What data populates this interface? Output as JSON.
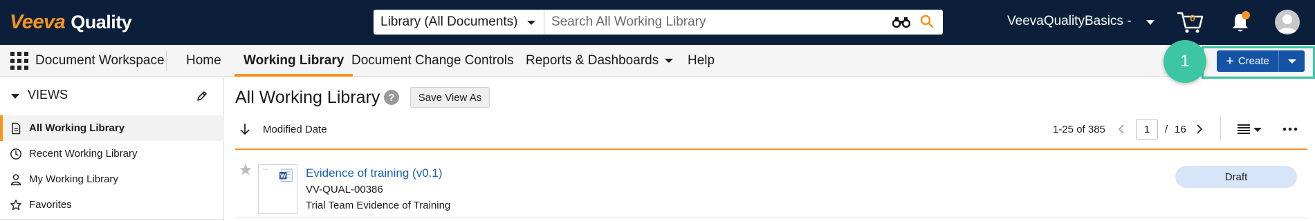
{
  "brand": {
    "veeva": "Veeva",
    "product": "Quality",
    "accent": "#f7941d",
    "topbar_bg": "#0b1f3a"
  },
  "search": {
    "scope": "Library (All Documents)",
    "placeholder": "Search All Working Library"
  },
  "header": {
    "vault_name": "VeevaQualityBasics -",
    "cart_count": "0"
  },
  "nav": {
    "workspace": "Document Workspace",
    "tabs": [
      {
        "label": "Home"
      },
      {
        "label": "Working Library",
        "active": true
      },
      {
        "label": "Document Change Controls"
      },
      {
        "label": "Reports & Dashboards",
        "has_dropdown": true
      },
      {
        "label": "Help"
      }
    ],
    "create_label": "Create",
    "step_number": "1"
  },
  "sidebar": {
    "views_label": "VIEWS",
    "items": [
      {
        "label": "All Working Library",
        "icon": "document-icon",
        "active": true
      },
      {
        "label": "Recent Working Library",
        "icon": "clock-icon"
      },
      {
        "label": "My Working Library",
        "icon": "user-icon"
      },
      {
        "label": "Favorites",
        "icon": "star-icon"
      }
    ]
  },
  "main": {
    "title": "All Working Library",
    "save_view_label": "Save View As",
    "sort_label": "Modified Date",
    "range": "1-25 of 385",
    "page_current": "1",
    "page_sep": "/",
    "page_total": "16"
  },
  "rows": [
    {
      "title": "Evidence of training (v0.1)",
      "number": "VV-QUAL-00386",
      "name": "Trial Team Evidence of Training",
      "status": "Draft",
      "status_color": "#d6e5f7"
    }
  ]
}
